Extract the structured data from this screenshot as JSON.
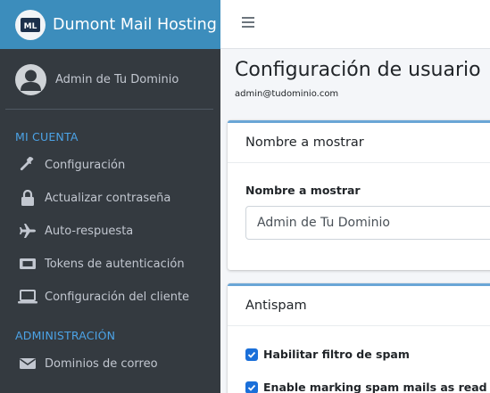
{
  "brand": {
    "name": "Dumont Mail Hosting",
    "logo_text": "ML",
    "logo_icon": "mail-logo-icon"
  },
  "user": {
    "name": "Admin de Tu Dominio",
    "avatar_icon": "user-avatar-icon"
  },
  "sidebar": {
    "section_account": "MI CUENTA",
    "account_items": [
      {
        "label": "Configuración",
        "icon": "wrench-icon"
      },
      {
        "label": "Actualizar contraseña",
        "icon": "lock-icon"
      },
      {
        "label": "Auto-respuesta",
        "icon": "plane-icon"
      },
      {
        "label": "Tokens de autenticación",
        "icon": "ticket-icon"
      },
      {
        "label": "Configuración del cliente",
        "icon": "laptop-icon"
      }
    ],
    "section_admin": "ADMINISTRACIÓN",
    "admin_items": [
      {
        "label": "Dominios de correo",
        "icon": "envelope-icon"
      }
    ]
  },
  "page": {
    "title": "Configuración de usuario",
    "subtitle": "admin@tudominio.com"
  },
  "display_card": {
    "header": "Nombre a mostrar",
    "field_label": "Nombre a mostrar",
    "field_value": "Admin de Tu Dominio"
  },
  "antispam_card": {
    "header": "Antispam",
    "options": [
      {
        "label": "Habilitar filtro de spam",
        "checked": true
      },
      {
        "label": "Enable marking spam mails as read",
        "checked": true
      }
    ]
  },
  "colors": {
    "sidebar_bg": "#343a40",
    "brand_bg": "#3c8dbc",
    "accent": "#4ca3e6",
    "checkbox": "#1a6fd9"
  }
}
